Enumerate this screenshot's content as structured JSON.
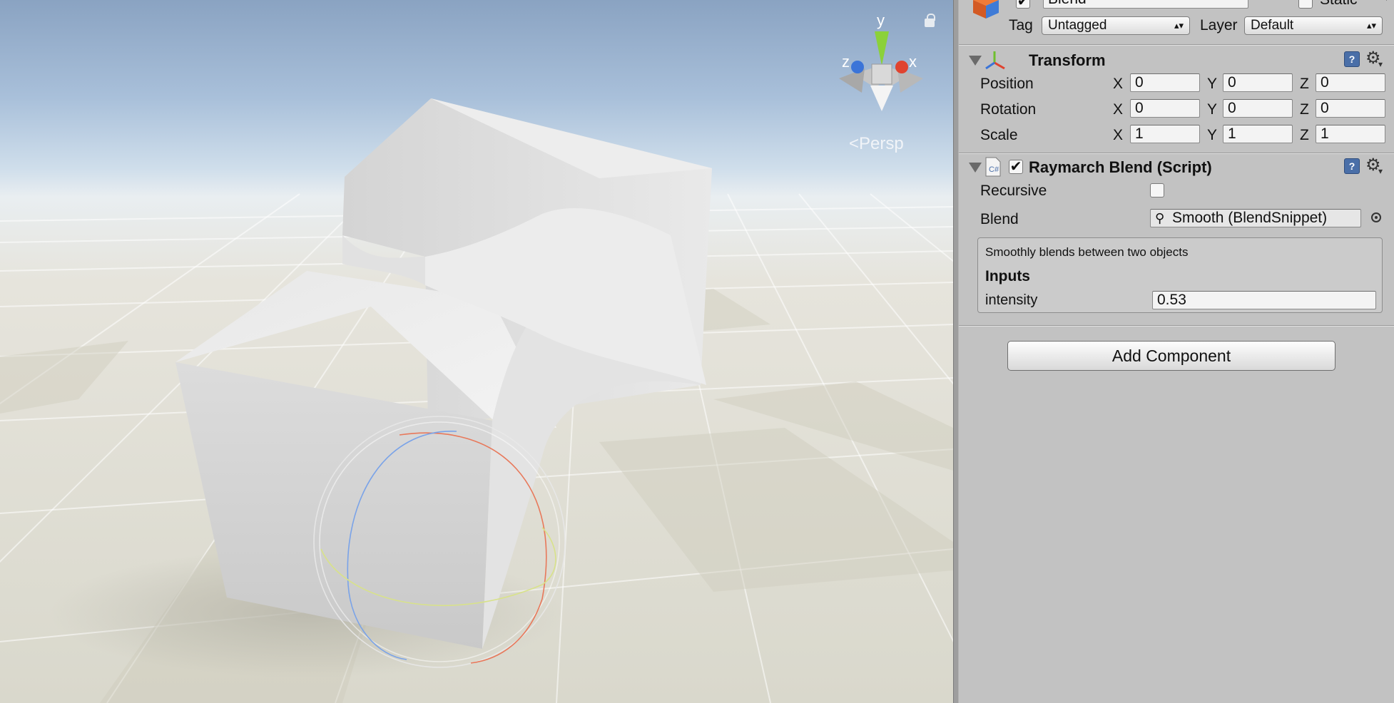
{
  "scene": {
    "projection_label": "Persp",
    "axis_labels": {
      "y": "y",
      "x": "x",
      "z": "z"
    },
    "colors": {
      "axis_y": "#8bd13a",
      "axis_x": "#e0432f",
      "axis_z": "#3b74d8",
      "sky_top": "#8aa3c2",
      "ground": "#dcdacd"
    }
  },
  "inspector": {
    "gameobject": {
      "name": "Blend",
      "active": true,
      "static_label": "Static",
      "static_checked": false
    },
    "tag": {
      "label": "Tag",
      "value": "Untagged"
    },
    "layer": {
      "label": "Layer",
      "value": "Default"
    },
    "transform": {
      "title": "Transform",
      "rows": [
        {
          "label": "Position",
          "x": "0",
          "y": "0",
          "z": "0"
        },
        {
          "label": "Rotation",
          "x": "0",
          "y": "0",
          "z": "0"
        },
        {
          "label": "Scale",
          "x": "1",
          "y": "1",
          "z": "1"
        }
      ],
      "axis_letters": {
        "x": "X",
        "y": "Y",
        "z": "Z"
      }
    },
    "script": {
      "title": "Raymarch Blend (Script)",
      "enabled": true,
      "recursive_label": "Recursive",
      "recursive_checked": false,
      "blend_label": "Blend",
      "blend_value": "Smooth (BlendSnippet)",
      "description": "Smoothly blends between two objects",
      "inputs_header": "Inputs",
      "intensity_label": "intensity",
      "intensity_value": "0.53"
    },
    "add_component_label": "Add Component"
  }
}
